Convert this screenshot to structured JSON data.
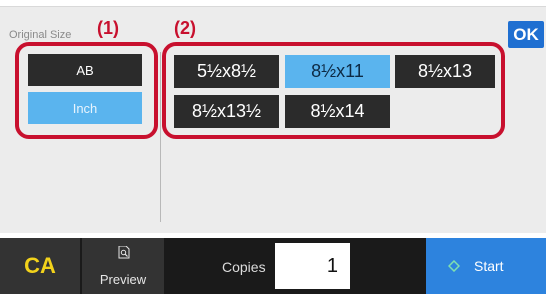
{
  "panel": {
    "title": "Original Size",
    "ok_label": "OK"
  },
  "callouts": [
    "(1)",
    "(2)"
  ],
  "left_group": {
    "options": [
      {
        "label": "AB",
        "selected": false
      },
      {
        "label": "Inch",
        "selected": true
      }
    ]
  },
  "sizes": [
    {
      "label": "5½x8½",
      "selected": false
    },
    {
      "label": "8½x11",
      "selected": true
    },
    {
      "label": "8½x13",
      "selected": false
    },
    {
      "label": "8½x13½",
      "selected": false
    },
    {
      "label": "8½x14",
      "selected": false
    }
  ],
  "footer": {
    "ca_label": "CA",
    "preview_label": "Preview",
    "copies_label": "Copies",
    "copies_value": "1",
    "start_label": "Start"
  },
  "colors": {
    "selected": "#5ab4ee",
    "unselected": "#2b2b2b",
    "highlight": "#c8102e",
    "start": "#2d83de",
    "ca_text": "#f2d21b"
  }
}
